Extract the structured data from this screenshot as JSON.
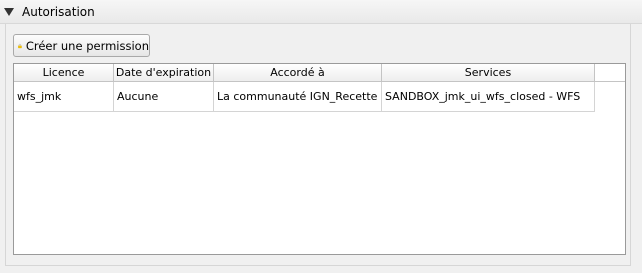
{
  "section": {
    "title": "Autorisation"
  },
  "toolbar": {
    "create_label": "Créer une permission"
  },
  "table": {
    "headers": [
      "Licence",
      "Date d'expiration",
      "Accordé à",
      "Services"
    ],
    "rows": [
      [
        "wfs_jmk",
        "Aucune",
        "La communauté IGN_Recette",
        "SANDBOX_jmk_ui_wfs_closed - WFS"
      ]
    ]
  },
  "icons": {
    "collapse": "triangle-down-icon",
    "create": "lock-icon"
  },
  "colors": {
    "lock": "#f2c200",
    "lock_shackle": "#b8b8b8"
  }
}
